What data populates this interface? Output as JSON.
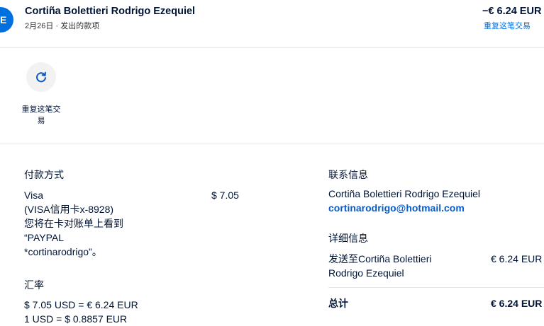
{
  "header": {
    "avatar_initial": "E",
    "name": "Cortiña Bolettieri Rodrigo Ezequiel",
    "subtitle": "2月26日 · 发出的款项",
    "amount": "−€ 6.24 EUR",
    "repeat_link": "重复这笔交易"
  },
  "action": {
    "icon": "refresh-icon",
    "label": "重复这笔交易"
  },
  "payment": {
    "title": "付款方式",
    "method_lines": [
      "Visa",
      "(VISA信用卡x-8928)",
      "您将在卡对账单上看到",
      "“PAYPAL",
      "*cortinarodrigo”。"
    ],
    "amount": "$ 7.05"
  },
  "exchange": {
    "title": "汇率",
    "line1": "$ 7.05 USD = € 6.24 EUR",
    "line2": "1 USD = $ 0.8857 EUR"
  },
  "contact": {
    "title": "联系信息",
    "name": "Cortiña Bolettieri Rodrigo Ezequiel",
    "email": "cortinarodrigo@hotmail.com"
  },
  "details": {
    "title": "详细信息",
    "sent_to_line1": "发送至Cortiña Bolettieri",
    "sent_to_line2": "Rodrigo Ezequiel",
    "sent_amount": "€ 6.24 EUR",
    "total_label": "总计",
    "total_amount": "€ 6.24 EUR"
  },
  "colors": {
    "accent": "#0070e0",
    "link": "#0a5ac6",
    "text": "#001435"
  }
}
